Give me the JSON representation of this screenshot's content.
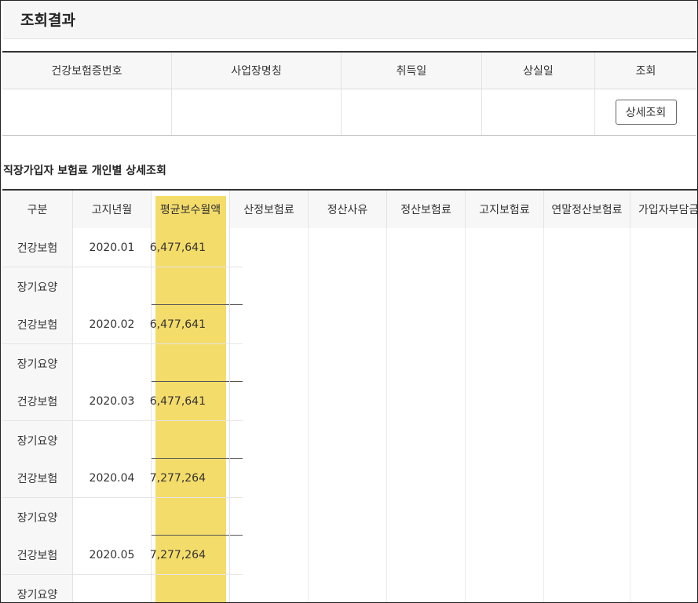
{
  "header": {
    "title": "조회결과"
  },
  "results": {
    "columns": [
      "건강보험증번호",
      "사업장명칭",
      "취득일",
      "상실일",
      "조회"
    ],
    "row": {
      "card_no": "",
      "workplace": "",
      "acquired": "",
      "lost": "",
      "detail_button": "상세조회"
    }
  },
  "detail_section": {
    "title": "직장가입자 보험료 개인별 상세조회",
    "columns": [
      "구분",
      "고지년월",
      "평균보수월액",
      "산정보험료",
      "정산사유",
      "정산보험료",
      "고지보험료",
      "연말정산보험료",
      "가입자부담금"
    ],
    "highlight_color": "#f4dc6a",
    "rows": [
      {
        "month": "2020.01",
        "amount": "6,477,641",
        "type_health": "건강보험",
        "type_care": "장기요양"
      },
      {
        "month": "2020.02",
        "amount": "6,477,641",
        "type_health": "건강보험",
        "type_care": "장기요양"
      },
      {
        "month": "2020.03",
        "amount": "6,477,641",
        "type_health": "건강보험",
        "type_care": "장기요양"
      },
      {
        "month": "2020.04",
        "amount": "7,277,264",
        "type_health": "건강보험",
        "type_care": "장기요양"
      },
      {
        "month": "2020.05",
        "amount": "7,277,264",
        "type_health": "건강보험",
        "type_care": "장기요양"
      }
    ]
  }
}
